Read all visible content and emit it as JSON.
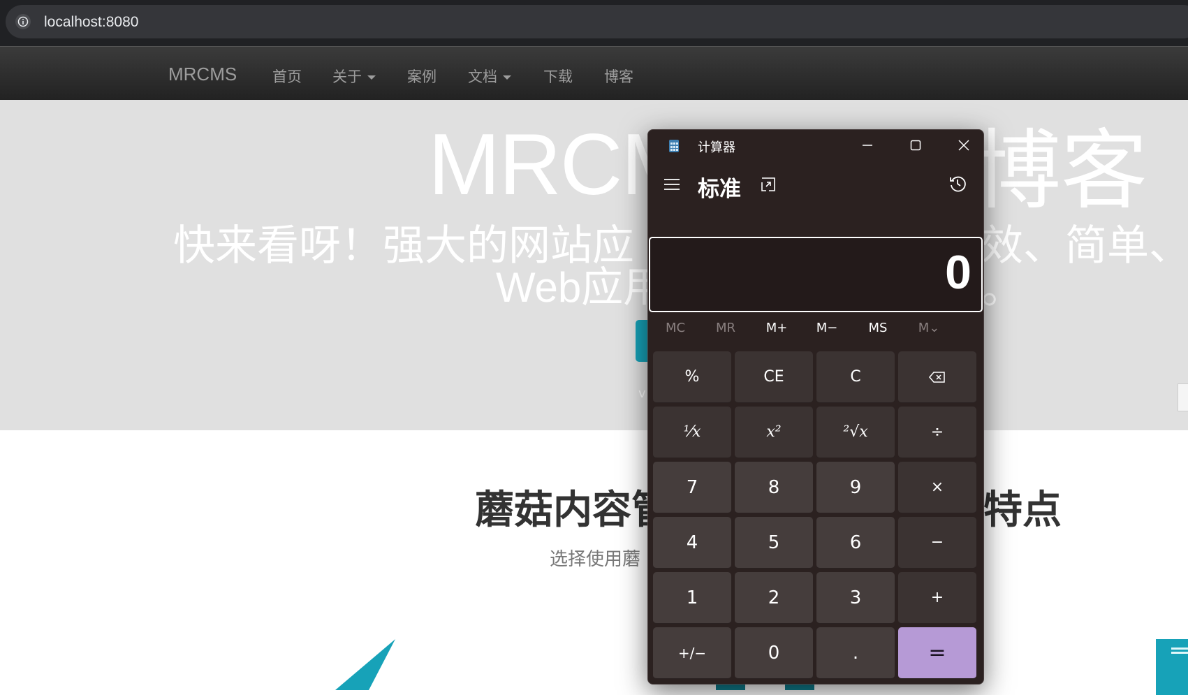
{
  "browser": {
    "url": "localhost:8080"
  },
  "nav": {
    "brand": "MRCMS",
    "items": [
      {
        "label": "首页",
        "dropdown": false
      },
      {
        "label": "关于",
        "dropdown": true
      },
      {
        "label": "案例",
        "dropdown": false
      },
      {
        "label": "文档",
        "dropdown": true
      },
      {
        "label": "下载",
        "dropdown": false
      },
      {
        "label": "博客",
        "dropdown": false
      }
    ]
  },
  "hero": {
    "title_visible_left": "MRCM",
    "title_visible_right": "博客",
    "subtitle_line1_left": "快来看呀！强大的网站应",
    "subtitle_line1_right": "效、简单、",
    "subtitle_line2_left": "Web应用",
    "subtitle_line2_right": "。",
    "version_fragment": "v"
  },
  "section": {
    "title_left": "蘑菇内容管",
    "title_right": "特点",
    "description_left": "选择使用蘑"
  },
  "calculator": {
    "window_title": "计算器",
    "mode": "标准",
    "display": "0",
    "memory_buttons": [
      {
        "label": "MC",
        "enabled": false
      },
      {
        "label": "MR",
        "enabled": false
      },
      {
        "label": "M+",
        "enabled": true
      },
      {
        "label": "M−",
        "enabled": true
      },
      {
        "label": "MS",
        "enabled": true
      },
      {
        "label": "M⌄",
        "enabled": false
      }
    ],
    "keys": [
      [
        "%",
        "CE",
        "C",
        "⌫"
      ],
      [
        "⅟x",
        "x²",
        "²√x",
        "÷"
      ],
      [
        "7",
        "8",
        "9",
        "×"
      ],
      [
        "4",
        "5",
        "6",
        "−"
      ],
      [
        "1",
        "2",
        "3",
        "+"
      ],
      [
        "+/−",
        "0",
        ".",
        "="
      ]
    ],
    "accent_color": "#b69ad6"
  }
}
